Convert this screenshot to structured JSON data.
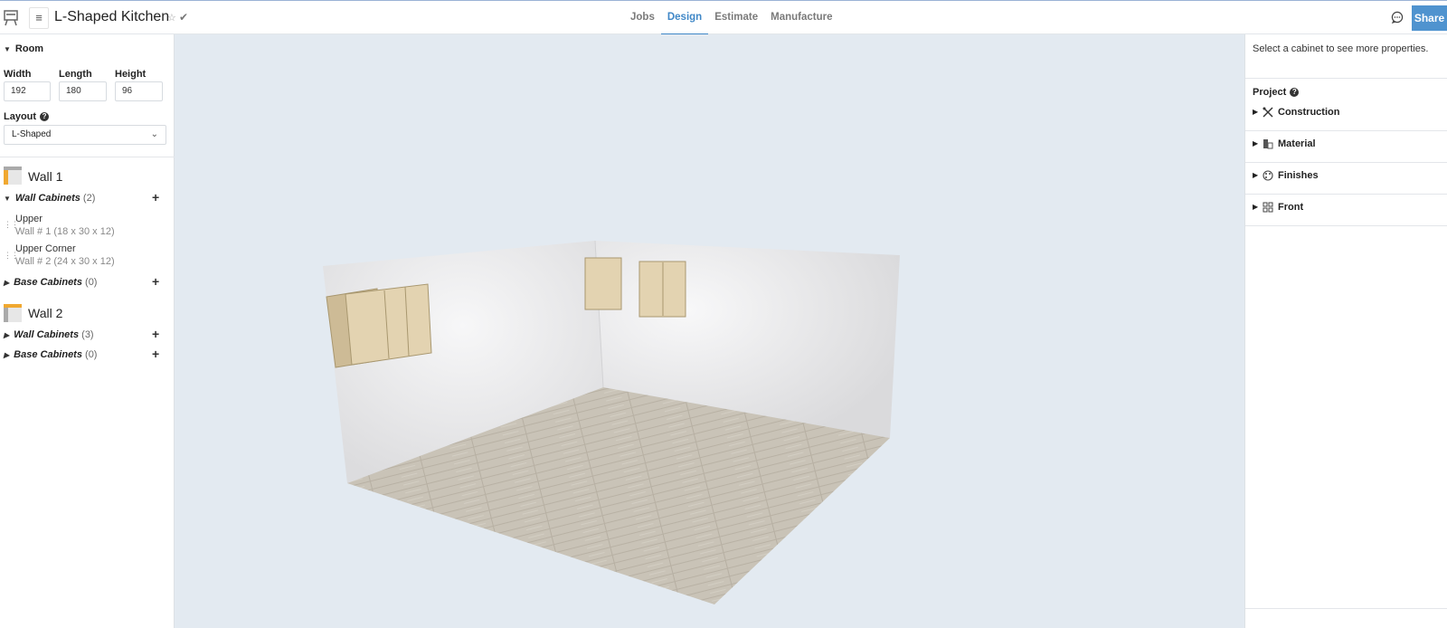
{
  "header": {
    "logo_icon": "easel-logo-icon",
    "menu_icon": "hamburger-icon",
    "title": "L-Shaped Kitchen",
    "star_icon": "☆",
    "saved_icon": "✔",
    "tabs": [
      {
        "label": "Jobs",
        "active": false
      },
      {
        "label": "Design",
        "active": true
      },
      {
        "label": "Estimate",
        "active": false
      },
      {
        "label": "Manufacture",
        "active": false
      }
    ],
    "share_label": "Share",
    "accent_color": "#3f87c7"
  },
  "room": {
    "heading": "Room",
    "width_label": "Width",
    "width_value": "192",
    "length_label": "Length",
    "length_value": "180",
    "height_label": "Height",
    "height_value": "96",
    "layout_label": "Layout",
    "layout_value": "L-Shaped"
  },
  "walls": [
    {
      "title": "Wall 1",
      "groups": [
        {
          "name": "Wall Cabinets",
          "count": "(2)",
          "expanded": true,
          "items": [
            {
              "name": "Upper",
              "detail": "Wall # 1 (18 x 30 x 12)"
            },
            {
              "name": "Upper Corner",
              "detail": "Wall # 2 (24 x 30 x 12)"
            }
          ]
        },
        {
          "name": "Base Cabinets",
          "count": "(0)",
          "expanded": false,
          "items": []
        }
      ]
    },
    {
      "title": "Wall 2",
      "groups": [
        {
          "name": "Wall Cabinets",
          "count": "(3)",
          "expanded": false,
          "items": []
        },
        {
          "name": "Base Cabinets",
          "count": "(0)",
          "expanded": false,
          "items": []
        }
      ]
    }
  ],
  "inspector": {
    "hint": "Select a cabinet to see more properties.",
    "project_label": "Project",
    "sections": [
      {
        "label": "Construction",
        "icon": "tools-icon"
      },
      {
        "label": "Material",
        "icon": "material-icon"
      },
      {
        "label": "Finishes",
        "icon": "palette-icon"
      },
      {
        "label": "Front",
        "icon": "grid-icon"
      }
    ]
  }
}
